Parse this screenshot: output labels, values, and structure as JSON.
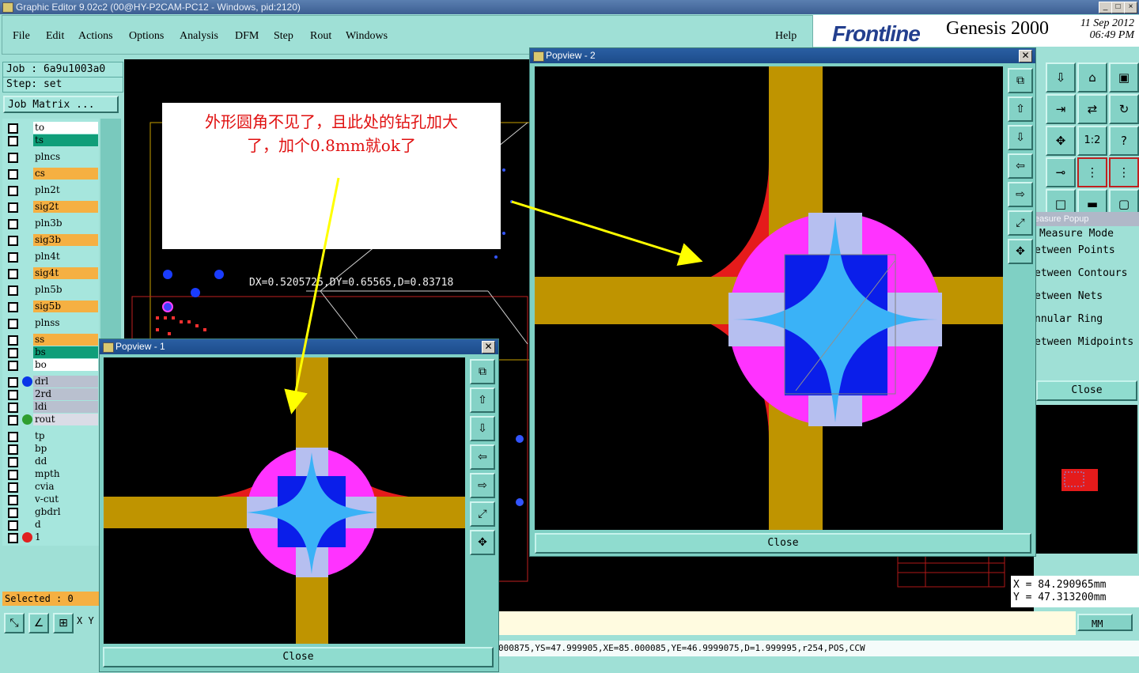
{
  "window": {
    "title": "Graphic Editor 9.02c2 (00@HY-P2CAM-PC12 - Windows, pid:2120)",
    "min": "_",
    "max": "□",
    "close": "×"
  },
  "menu": [
    "File",
    "Edit",
    "Actions",
    "Options",
    "Analysis",
    "DFM",
    "Step",
    "Rout",
    "Windows"
  ],
  "help": "Help",
  "brand": {
    "logo": "Frontline",
    "product": "Genesis 2000",
    "date": "11 Sep 2012",
    "time": "06:49 PM"
  },
  "job": {
    "job": "Job : 6a9u1003a0",
    "step": "Step: set",
    "matrix": "Job Matrix ..."
  },
  "layers": [
    {
      "name": "to",
      "bg": "#ffffff"
    },
    {
      "name": "ts",
      "bg": "#0f9e79"
    },
    {
      "name": "plncs",
      "bg": "#a6e6dd"
    },
    {
      "name": "cs",
      "bg": "#f5b042"
    },
    {
      "name": "pln2t",
      "bg": "#a6e6dd"
    },
    {
      "name": "sig2t",
      "bg": "#f5b042"
    },
    {
      "name": "pln3b",
      "bg": "#a6e6dd"
    },
    {
      "name": "sig3b",
      "bg": "#f5b042"
    },
    {
      "name": "pln4t",
      "bg": "#a6e6dd"
    },
    {
      "name": "sig4t",
      "bg": "#f5b042"
    },
    {
      "name": "pln5b",
      "bg": "#a6e6dd"
    },
    {
      "name": "sig5b",
      "bg": "#f5b042"
    },
    {
      "name": "plnss",
      "bg": "#a6e6dd"
    },
    {
      "name": "ss",
      "bg": "#f5b042"
    },
    {
      "name": "bs",
      "bg": "#0f9e79"
    },
    {
      "name": "bo",
      "bg": "#ffffff"
    },
    {
      "name": "drl",
      "bg": "#b9c0cf",
      "dot": "#0a36e8"
    },
    {
      "name": "2rd",
      "bg": "#b9c0cf"
    },
    {
      "name": "ldi",
      "bg": "#b9c0cf"
    },
    {
      "name": "rout",
      "bg": "#dadce6",
      "dot": "#2f9e2f"
    },
    {
      "name": "tp",
      "bg": "#a6e6dd"
    },
    {
      "name": "bp",
      "bg": "#a6e6dd"
    },
    {
      "name": "dd",
      "bg": "#a6e6dd"
    },
    {
      "name": "mpth",
      "bg": "#a6e6dd"
    },
    {
      "name": "cvia",
      "bg": "#a6e6dd"
    },
    {
      "name": "v-cut",
      "bg": "#a6e6dd"
    },
    {
      "name": "gbdrl",
      "bg": "#a6e6dd"
    },
    {
      "name": "d",
      "bg": "#a6e6dd"
    },
    {
      "name": "1",
      "bg": "#a6e6dd",
      "dot": "#e02020"
    }
  ],
  "selected": "Selected : 0",
  "xy_short": "X Y",
  "measure_text": "DX=0.5205725,DY=0.65565,D=0.83718",
  "annotation": {
    "line1": "外形圆角不见了，且此处的钻孔加大",
    "line2": "了，加个0.8mm就ok了"
  },
  "popview1": {
    "title": "Popview - 1",
    "close": "Close"
  },
  "popview2": {
    "title": "Popview - 2",
    "close": "Close"
  },
  "measure_popup": {
    "title": "easure Popup",
    "mode": "Measure Mode",
    "options": [
      "etween Points",
      "etween Contours",
      "etween Nets",
      "nnular Ring",
      "etween Midpoints"
    ],
    "close": "Close"
  },
  "coords": {
    "x": "X  = 84.290965mm",
    "y": "Y  = 47.313200mm"
  },
  "units": "MM",
  "feature_line": "000875,YS=47.999905,XE=85.000085,YE=46.9999075,D=1.999995,r254,POS,CCW",
  "colors": {
    "pad": "#e51b1b",
    "trace": "#bf9400",
    "ring": "#ff33ff",
    "hole": "#b6bff0",
    "inner": "#3ab2f7",
    "deep": "#0a1eea"
  }
}
